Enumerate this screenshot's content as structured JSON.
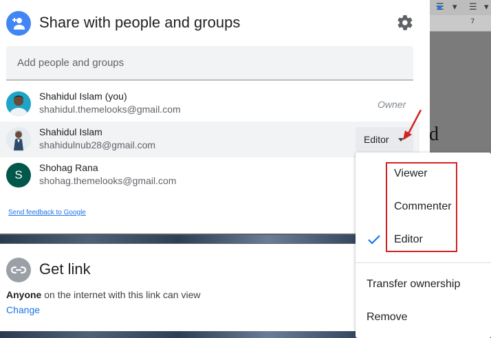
{
  "share": {
    "title": "Share with people and groups",
    "settings_icon": "gear-icon",
    "input_placeholder": "Add people and groups"
  },
  "people": [
    {
      "name": "Shahidul Islam (you)",
      "email": "shahidul.themelooks@gmail.com",
      "role": "Owner",
      "avatar": "photo"
    },
    {
      "name": "Shahidul Islam",
      "email": "shahidulnub28@gmail.com",
      "role": "Editor",
      "avatar": "photo"
    },
    {
      "name": "Shohag Rana",
      "email": "shohag.themelooks@gmail.com",
      "avatar_letter": "S"
    }
  ],
  "feedback_link": "Send feedback to Google",
  "get_link": {
    "title": "Get link",
    "access_strong": "Anyone",
    "access_rest": " on the internet with this link can view",
    "change": "Change"
  },
  "role_menu": {
    "items": [
      "Viewer",
      "Commenter",
      "Editor"
    ],
    "selected": "Editor",
    "actions": [
      "Transfer ownership",
      "Remove"
    ]
  },
  "background_doc": {
    "ruler_number": "7",
    "letter": "d"
  },
  "colors": {
    "accent": "#1a73e8",
    "share_icon_bg": "#4285f4",
    "annotation": "#d32020",
    "avatar_letter_bg": "#00584a"
  }
}
